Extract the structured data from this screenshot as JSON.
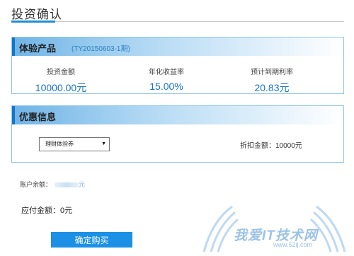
{
  "page": {
    "title": "投资确认"
  },
  "product": {
    "header": "体验产品",
    "code": "(TY20150603-1期)",
    "stats": [
      {
        "label": "投资金额",
        "value": "10000.00元"
      },
      {
        "label": "年化收益率",
        "value": "15.00%"
      },
      {
        "label": "预计到期利率",
        "value": "20.83元"
      }
    ]
  },
  "coupon": {
    "header": "优惠信息",
    "select_value": "理财体验券",
    "discount_label": "折扣金额：",
    "discount_value": "10000元"
  },
  "account": {
    "balance_label": "账户余额：",
    "balance_unit": "元",
    "payable": "应付金额：0元"
  },
  "actions": {
    "confirm": "确定购买"
  },
  "watermark": {
    "text": "我爱IT技术网",
    "url": "www.52ij.com"
  },
  "colors": {
    "accent": "#1e8ed6",
    "button": "#1b90e5",
    "value_text": "#1a72c4"
  }
}
